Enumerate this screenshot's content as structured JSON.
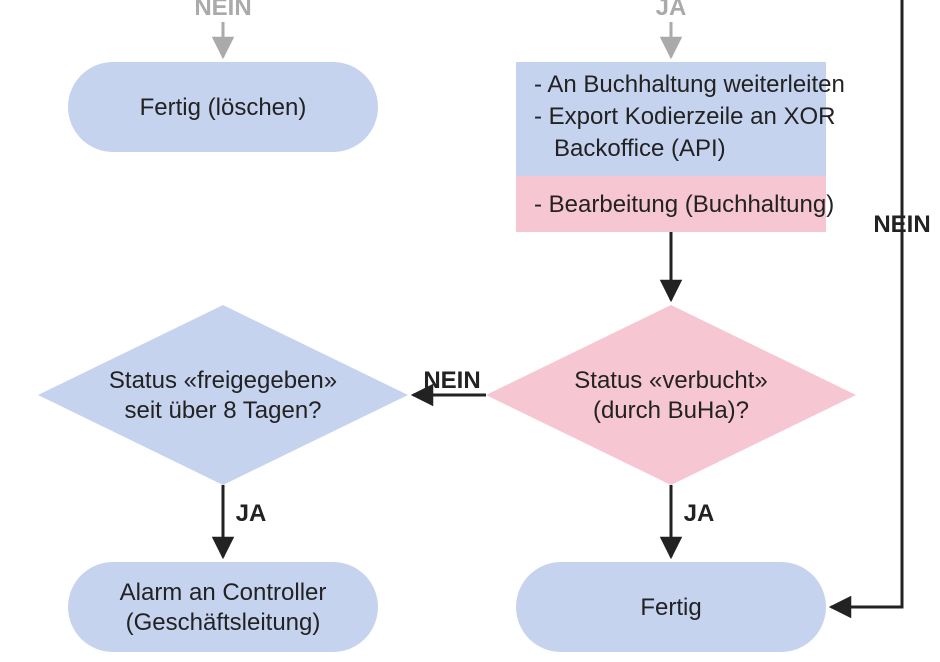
{
  "labels": {
    "nein_top": "NEIN",
    "ja_top": "JA",
    "fertig_loeschen": "Fertig (löschen)",
    "process_line1": "-  An Buchhaltung weiterleiten",
    "process_line2": "-  Export Kodierzeile an XOR",
    "process_line3": "   Backoffice (API)",
    "process_pink": "-  Bearbeitung (Buchhaltung)",
    "nein_middle": "NEIN",
    "nein_right": "NEIN",
    "diamond_left_l1": "Status «freigegeben»",
    "diamond_left_l2": "seit über 8 Tagen?",
    "diamond_right_l1": "Status «verbucht»",
    "diamond_right_l2": "(durch BuHa)?",
    "ja_left": "JA",
    "ja_right": "JA",
    "terminal_left_l1": "Alarm an Controller",
    "terminal_left_l2": "(Geschäftsleitung)",
    "terminal_right": "Fertig"
  },
  "colors": {
    "blue": "#c6d3ef",
    "pink": "#f7c6d3",
    "text": "#222222",
    "faded": "#aaaaaa"
  }
}
